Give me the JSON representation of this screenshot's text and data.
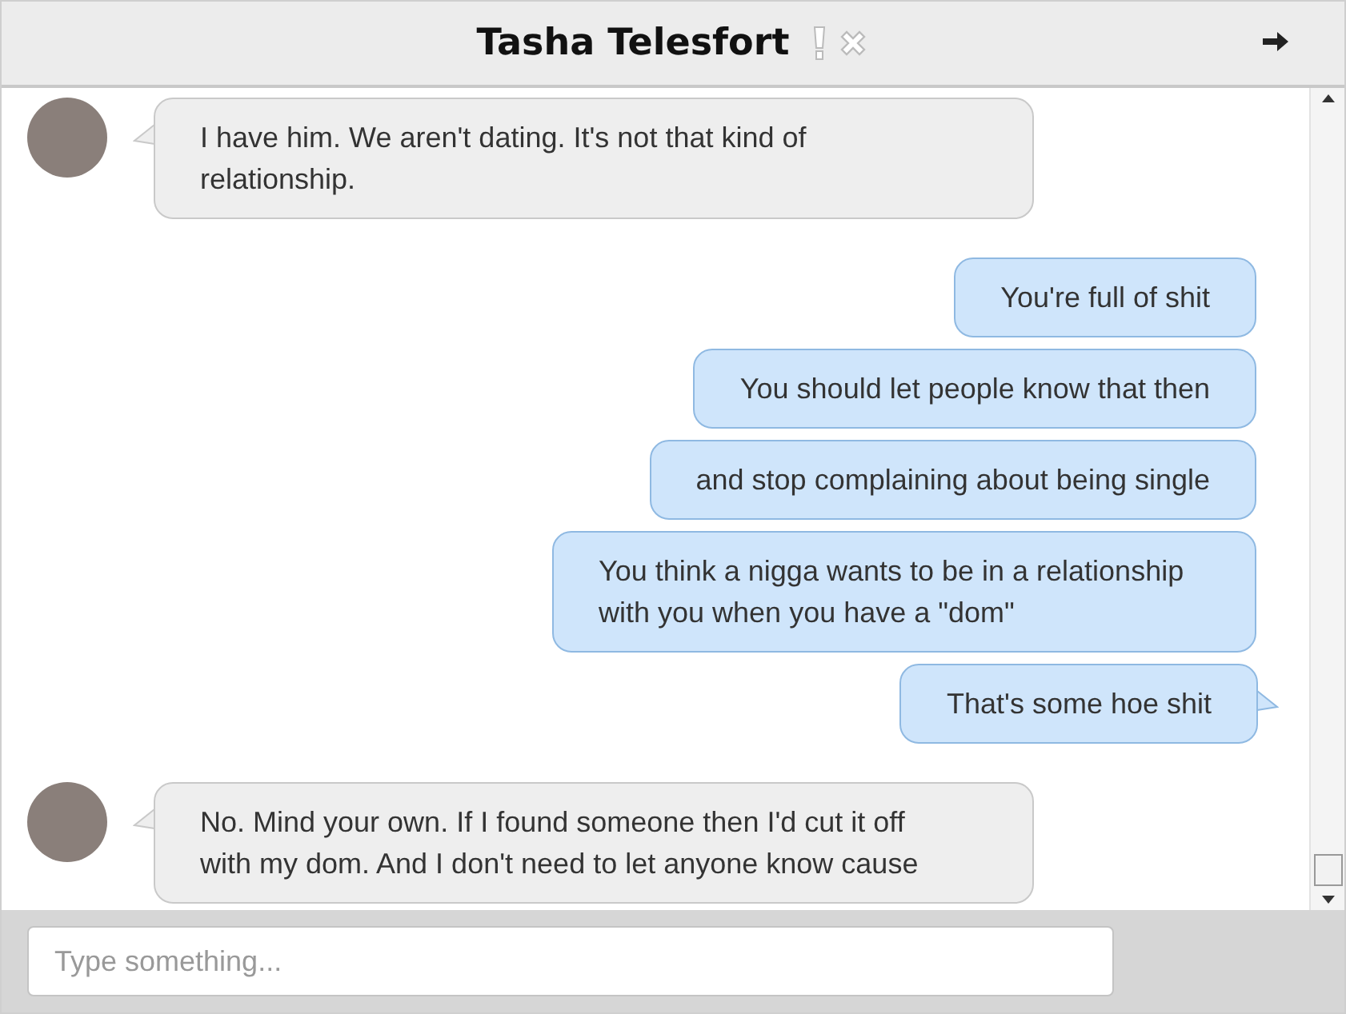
{
  "header": {
    "title": "Tasha Telesfort"
  },
  "messages": [
    {
      "kind": "in",
      "text": "I have him. We aren't dating. It's not that kind of relationship."
    },
    {
      "kind": "out",
      "text": "You're full of shit"
    },
    {
      "kind": "out",
      "text": "You should let people know that then"
    },
    {
      "kind": "out",
      "text": "and stop complaining about being single"
    },
    {
      "kind": "out",
      "text": "You think a nigga wants to be in a relationship with you when you have a \"dom\""
    },
    {
      "kind": "out",
      "text": "That's some hoe shit"
    },
    {
      "kind": "in",
      "text": "No. Mind your own. If I found someone then I'd cut it off with my dom. And I don't need to let anyone know cause"
    }
  ],
  "composer": {
    "placeholder": "Type something..."
  }
}
